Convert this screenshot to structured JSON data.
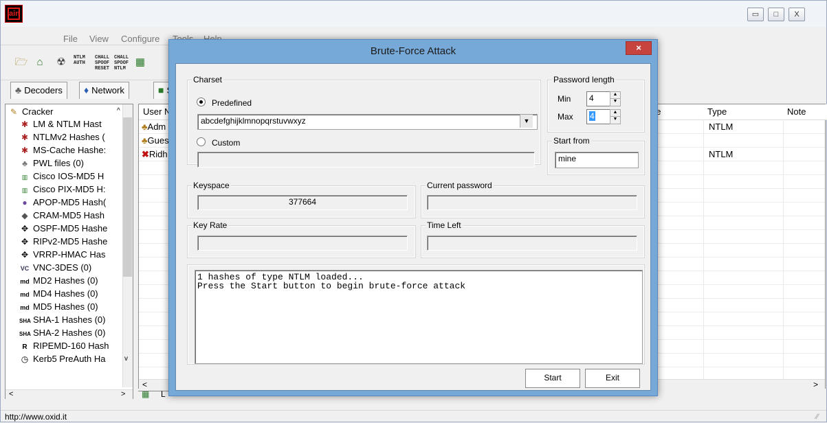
{
  "window": {
    "app_icon_text": "ain",
    "minimize_glyph": "▭",
    "maximize_glyph": "□",
    "close_glyph": "X"
  },
  "menu": [
    "File",
    "View",
    "Configure",
    "Tools",
    "Help"
  ],
  "toolbar": {
    "ntlm_auth": "NTLM\nAUTH",
    "chall_spoof_reset": "CHALL\nSPOOF\nRESET",
    "chall_spoof_ntlm": "CHALL\nSPOOF\nNTLM"
  },
  "tabs": [
    {
      "label": "Decoders",
      "icon": "decoder-icon"
    },
    {
      "label": "Network",
      "icon": "network-icon"
    },
    {
      "label": "S",
      "icon": "sniffer-icon"
    }
  ],
  "tree": {
    "root": "Cracker",
    "items": [
      "LM & NTLM Hast",
      "NTLMv2 Hashes (",
      "MS-Cache Hashe:",
      "PWL files (0)",
      "Cisco IOS-MD5 H",
      "Cisco PIX-MD5 H:",
      "APOP-MD5 Hash(",
      "CRAM-MD5 Hash",
      "OSPF-MD5 Hashe",
      "RIPv2-MD5 Hashe",
      "VRRP-HMAC Has",
      "VNC-3DES (0)",
      "MD2 Hashes (0)",
      "MD4 Hashes (0)",
      "MD5 Hashes (0)",
      "SHA-1 Hashes (0)",
      "SHA-2 Hashes (0)",
      "RIPEMD-160 Hash",
      "Kerb5 PreAuth Ha"
    ]
  },
  "table": {
    "headers": {
      "user": "User N",
      "ge": "ge",
      "type": "Type",
      "note": "Note"
    },
    "rows": [
      {
        "user": "Adm",
        "type": "NTLM"
      },
      {
        "user": "Gues",
        "type": ""
      },
      {
        "user": "Ridh",
        "type": "NTLM"
      }
    ]
  },
  "bottom_tab_label": "L",
  "status": {
    "text": "http://www.oxid.it"
  },
  "dialog": {
    "title": "Brute-Force Attack",
    "close": "×",
    "charset_label": "Charset",
    "predefined_label": "Predefined",
    "predefined_value": "abcdefghijklmnopqrstuvwxyz",
    "custom_label": "Custom",
    "custom_value": "",
    "password_length_label": "Password length",
    "min_label": "Min",
    "min_value": "4",
    "max_label": "Max",
    "max_value": "4",
    "start_from_label": "Start from",
    "start_from_value": "mine",
    "keyspace_label": "Keyspace",
    "keyspace_value": "377664",
    "current_password_label": "Current password",
    "current_password_value": "",
    "key_rate_label": "Key Rate",
    "key_rate_value": "",
    "time_left_label": "Time Left",
    "time_left_value": "",
    "log": "1 hashes of type NTLM loaded...\nPress the Start button to begin brute-force attack",
    "start_button": "Start",
    "exit_button": "Exit"
  }
}
